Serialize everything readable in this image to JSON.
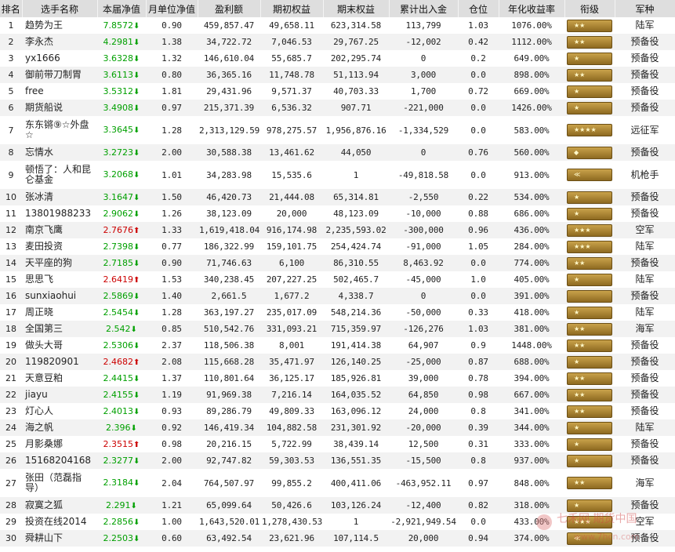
{
  "headers": [
    "排名",
    "选手名称",
    "本届净值",
    "月单位净值",
    "盈利额",
    "期初权益",
    "期末权益",
    "累计出入金",
    "仓位",
    "年化收益率",
    "衔级",
    "军种"
  ],
  "rows": [
    {
      "rank": "1",
      "name": "趋势为王",
      "nav": "7.8572",
      "dir": "down",
      "monthly": "0.90",
      "profit": "459,857.47",
      "start": "49,658.11",
      "end": "623,314.58",
      "flow": "113,799",
      "pos": "1.03",
      "annual": "1076.00%",
      "army": "陆军"
    },
    {
      "rank": "2",
      "name": "李永杰",
      "nav": "4.2981",
      "dir": "down",
      "monthly": "1.38",
      "profit": "34,722.72",
      "start": "7,046.53",
      "end": "29,767.25",
      "flow": "-12,002",
      "pos": "0.42",
      "annual": "1112.00%",
      "army": "预备役"
    },
    {
      "rank": "3",
      "name": "yx1666",
      "nav": "3.6328",
      "dir": "down",
      "monthly": "1.32",
      "profit": "146,610.04",
      "start": "55,685.7",
      "end": "202,295.74",
      "flow": "0",
      "pos": "0.2",
      "annual": "649.00%",
      "army": "预备役"
    },
    {
      "rank": "4",
      "name": "御前带刀制胃",
      "nav": "3.6113",
      "dir": "down",
      "monthly": "0.80",
      "profit": "36,365.16",
      "start": "11,748.78",
      "end": "51,113.94",
      "flow": "3,000",
      "pos": "0.0",
      "annual": "898.00%",
      "army": "预备役"
    },
    {
      "rank": "5",
      "name": "free",
      "nav": "3.5312",
      "dir": "down",
      "monthly": "1.81",
      "profit": "29,431.96",
      "start": "9,571.37",
      "end": "40,703.33",
      "flow": "1,700",
      "pos": "0.72",
      "annual": "669.00%",
      "army": "预备役"
    },
    {
      "rank": "6",
      "name": "期货船说",
      "nav": "3.4908",
      "dir": "down",
      "monthly": "0.97",
      "profit": "215,371.39",
      "start": "6,536.32",
      "end": "907.71",
      "flow": "-221,000",
      "pos": "0.0",
      "annual": "1426.00%",
      "army": "预备役"
    },
    {
      "rank": "7",
      "name": "东东锵⑨☆外盘☆",
      "nav": "3.3645",
      "dir": "down",
      "monthly": "1.28",
      "profit": "2,313,129.59",
      "start": "978,275.57",
      "end": "1,956,876.16",
      "flow": "-1,334,529",
      "pos": "0.0",
      "annual": "583.00%",
      "army": "远征军",
      "tall": true
    },
    {
      "rank": "8",
      "name": "忘情水",
      "nav": "3.2723",
      "dir": "down",
      "monthly": "2.00",
      "profit": "30,588.38",
      "start": "13,461.62",
      "end": "44,050",
      "flow": "0",
      "pos": "0.76",
      "annual": "560.00%",
      "army": "预备役"
    },
    {
      "rank": "9",
      "name": "顿悟了：人和昆仑基金",
      "nav": "3.2068",
      "dir": "down",
      "monthly": "1.01",
      "profit": "34,283.98",
      "start": "15,535.6",
      "end": "1",
      "flow": "-49,818.58",
      "pos": "0.0",
      "annual": "913.00%",
      "army": "机枪手",
      "tall": true
    },
    {
      "rank": "10",
      "name": "张冰清",
      "nav": "3.1647",
      "dir": "down",
      "monthly": "1.50",
      "profit": "46,420.73",
      "start": "21,444.08",
      "end": "65,314.81",
      "flow": "-2,550",
      "pos": "0.22",
      "annual": "534.00%",
      "army": "预备役"
    },
    {
      "rank": "11",
      "name": "13801988233",
      "nav": "2.9062",
      "dir": "down",
      "monthly": "1.26",
      "profit": "38,123.09",
      "start": "20,000",
      "end": "48,123.09",
      "flow": "-10,000",
      "pos": "0.88",
      "annual": "686.00%",
      "army": "预备役"
    },
    {
      "rank": "12",
      "name": "南京飞鹰",
      "nav": "2.7676",
      "dir": "up",
      "monthly": "1.33",
      "profit": "1,619,418.04",
      "start": "916,174.98",
      "end": "2,235,593.02",
      "flow": "-300,000",
      "pos": "0.96",
      "annual": "436.00%",
      "army": "空军"
    },
    {
      "rank": "13",
      "name": "麦田投资",
      "nav": "2.7398",
      "dir": "down",
      "monthly": "0.77",
      "profit": "186,322.99",
      "start": "159,101.75",
      "end": "254,424.74",
      "flow": "-91,000",
      "pos": "1.05",
      "annual": "284.00%",
      "army": "陆军"
    },
    {
      "rank": "14",
      "name": "天平座的狗",
      "nav": "2.7185",
      "dir": "down",
      "monthly": "0.90",
      "profit": "71,746.63",
      "start": "6,100",
      "end": "86,310.55",
      "flow": "8,463.92",
      "pos": "0.0",
      "annual": "774.00%",
      "army": "预备役"
    },
    {
      "rank": "15",
      "name": "思思飞",
      "nav": "2.6419",
      "dir": "up",
      "monthly": "1.53",
      "profit": "340,238.45",
      "start": "207,227.25",
      "end": "502,465.7",
      "flow": "-45,000",
      "pos": "1.0",
      "annual": "405.00%",
      "army": "陆军"
    },
    {
      "rank": "16",
      "name": "sunxiaohui",
      "nav": "2.5869",
      "dir": "down",
      "monthly": "1.40",
      "profit": "2,661.5",
      "start": "1,677.2",
      "end": "4,338.7",
      "flow": "0",
      "pos": "0.0",
      "annual": "391.00%",
      "army": "预备役"
    },
    {
      "rank": "17",
      "name": "周正晓",
      "nav": "2.5454",
      "dir": "down",
      "monthly": "1.28",
      "profit": "363,197.27",
      "start": "235,017.09",
      "end": "548,214.36",
      "flow": "-50,000",
      "pos": "0.33",
      "annual": "418.00%",
      "army": "陆军"
    },
    {
      "rank": "18",
      "name": "全国第三",
      "nav": "2.542",
      "dir": "down",
      "monthly": "0.85",
      "profit": "510,542.76",
      "start": "331,093.21",
      "end": "715,359.97",
      "flow": "-126,276",
      "pos": "1.03",
      "annual": "381.00%",
      "army": "海军"
    },
    {
      "rank": "19",
      "name": "做头大哥",
      "nav": "2.5306",
      "dir": "down",
      "monthly": "2.37",
      "profit": "118,506.38",
      "start": "8,001",
      "end": "191,414.38",
      "flow": "64,907",
      "pos": "0.9",
      "annual": "1448.00%",
      "army": "预备役"
    },
    {
      "rank": "20",
      "name": "119820901",
      "nav": "2.4682",
      "dir": "up",
      "monthly": "2.08",
      "profit": "115,668.28",
      "start": "35,471.97",
      "end": "126,140.25",
      "flow": "-25,000",
      "pos": "0.87",
      "annual": "688.00%",
      "army": "预备役"
    },
    {
      "rank": "21",
      "name": "天意豆粕",
      "nav": "2.4415",
      "dir": "down",
      "monthly": "1.37",
      "profit": "110,801.64",
      "start": "36,125.17",
      "end": "185,926.81",
      "flow": "39,000",
      "pos": "0.78",
      "annual": "394.00%",
      "army": "预备役"
    },
    {
      "rank": "22",
      "name": "jiayu",
      "nav": "2.4155",
      "dir": "down",
      "monthly": "1.19",
      "profit": "91,969.38",
      "start": "7,216.14",
      "end": "164,035.52",
      "flow": "64,850",
      "pos": "0.98",
      "annual": "667.00%",
      "army": "预备役"
    },
    {
      "rank": "23",
      "name": "灯心人",
      "nav": "2.4013",
      "dir": "down",
      "monthly": "0.93",
      "profit": "89,286.79",
      "start": "49,809.33",
      "end": "163,096.12",
      "flow": "24,000",
      "pos": "0.8",
      "annual": "341.00%",
      "army": "预备役"
    },
    {
      "rank": "24",
      "name": "海之帆",
      "nav": "2.396",
      "dir": "down",
      "monthly": "0.92",
      "profit": "146,419.34",
      "start": "104,882.58",
      "end": "231,301.92",
      "flow": "-20,000",
      "pos": "0.39",
      "annual": "344.00%",
      "army": "陆军"
    },
    {
      "rank": "25",
      "name": "月影桑娜",
      "nav": "2.3515",
      "dir": "up",
      "monthly": "0.98",
      "profit": "20,216.15",
      "start": "5,722.99",
      "end": "38,439.14",
      "flow": "12,500",
      "pos": "0.31",
      "annual": "333.00%",
      "army": "预备役"
    },
    {
      "rank": "26",
      "name": "15168204168",
      "nav": "2.3277",
      "dir": "down",
      "monthly": "2.00",
      "profit": "92,747.82",
      "start": "59,303.53",
      "end": "136,551.35",
      "flow": "-15,500",
      "pos": "0.8",
      "annual": "937.00%",
      "army": "预备役"
    },
    {
      "rank": "27",
      "name": "张田（范磊指导）",
      "nav": "2.3184",
      "dir": "down",
      "monthly": "2.04",
      "profit": "764,507.97",
      "start": "99,855.2",
      "end": "400,411.06",
      "flow": "-463,952.11",
      "pos": "0.97",
      "annual": "848.00%",
      "army": "海军",
      "tall": true
    },
    {
      "rank": "28",
      "name": "寂寞之狐",
      "nav": "2.291",
      "dir": "down",
      "monthly": "1.21",
      "profit": "65,099.64",
      "start": "50,426.6",
      "end": "103,126.24",
      "flow": "-12,400",
      "pos": "0.82",
      "annual": "318.00%",
      "army": "预备役"
    },
    {
      "rank": "29",
      "name": "投资在线2014",
      "nav": "2.2856",
      "dir": "down",
      "monthly": "1.00",
      "profit": "1,643,520.01",
      "start": "1,278,430.53",
      "end": "1",
      "flow": "-2,921,949.54",
      "pos": "0.0",
      "annual": "433.00%",
      "army": "空军"
    },
    {
      "rank": "30",
      "name": "舜耕山下",
      "nav": "2.2503",
      "dir": "down",
      "monthly": "0.60",
      "profit": "63,492.54",
      "start": "23,621.96",
      "end": "107,114.5",
      "flow": "20,000",
      "pos": "0.94",
      "annual": "374.00%",
      "army": "预备役"
    }
  ],
  "badge_icon": "rank-insignia-icon",
  "colors": {
    "header_bg": "#dedede",
    "up": "#cc0000",
    "down": "#00a000",
    "badge": "#b8913a",
    "alt_row": "#f2f2f2"
  },
  "watermark": {
    "text": "七禾网 期货中国",
    "url": "www.7hcn.com"
  }
}
